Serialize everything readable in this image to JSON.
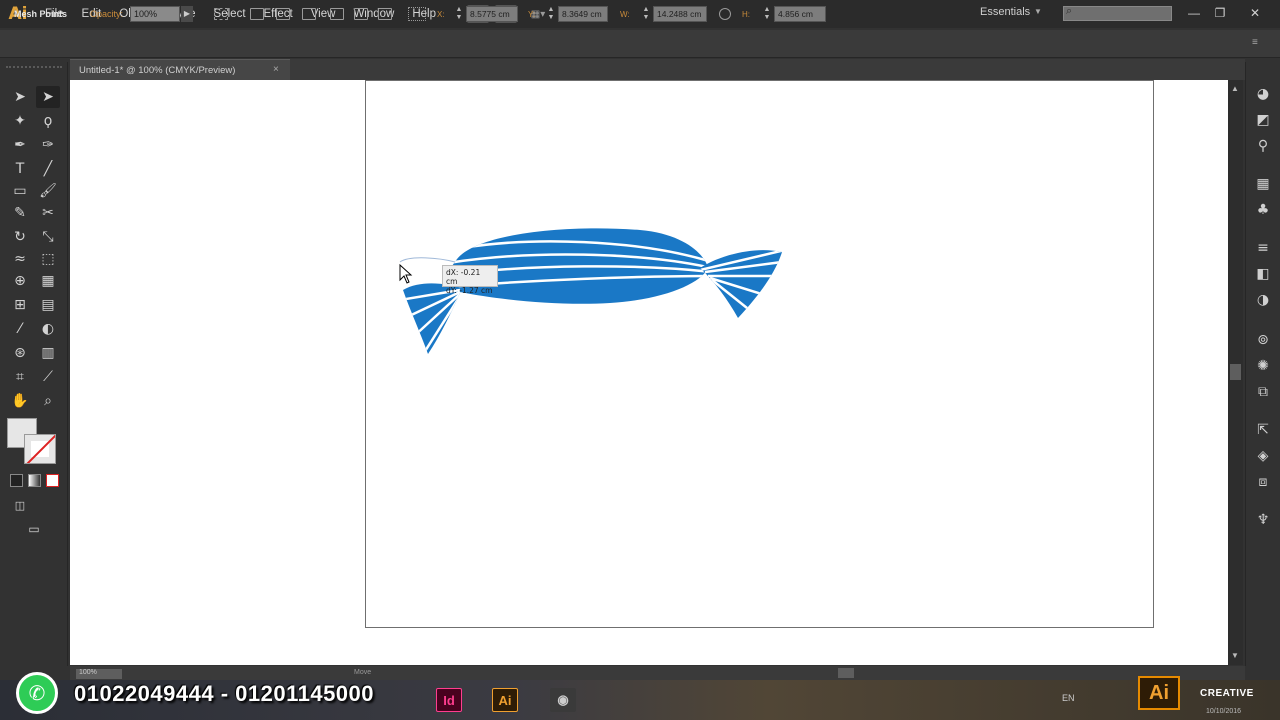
{
  "app": {
    "logo": "Ai"
  },
  "menu": [
    "File",
    "Edit",
    "Object",
    "Type",
    "Select",
    "Effect",
    "View",
    "Window",
    "Help"
  ],
  "workspace": {
    "label": "Essentials"
  },
  "controlbar": {
    "tool_name": "Mesh Points",
    "opacity_label": "Opacity:",
    "opacity_value": "100%",
    "x_label": "X:",
    "x_value": "8.5775 cm",
    "y_label": "Y:",
    "y_value": "8.3649 cm",
    "w_label": "W:",
    "w_value": "14.2488 cm",
    "h_label": "H:",
    "h_value": "4.856 cm"
  },
  "document": {
    "tab_title": "Untitled-1* @ 100% (CMYK/Preview)"
  },
  "tooltip": {
    "dx": "dX: -0.21 cm",
    "dy": "dY: -1.27 cm"
  },
  "statusbar": {
    "zoom": "100%",
    "status": "Move"
  },
  "overlay": {
    "phone_numbers": "01022049444 - 01201145000"
  },
  "taskbar": {
    "language": "EN",
    "ai_badge": "Ai",
    "brand": "CREATIVE",
    "date": "10/10/2016"
  },
  "colors": {
    "artwork_blue": "#1a78c6",
    "accent_orange": "#e68a00",
    "app_bg": "#323232"
  }
}
